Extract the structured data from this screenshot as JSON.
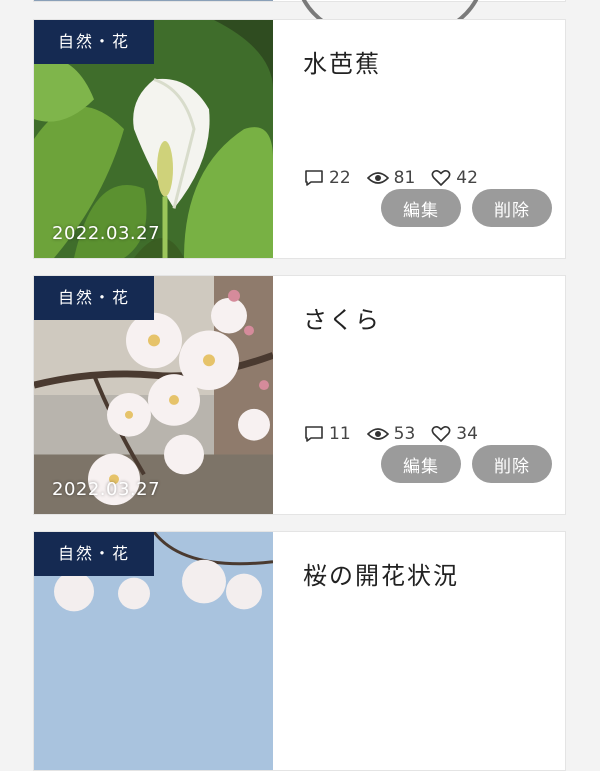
{
  "posts": [
    {
      "category": "自然・花",
      "title": "水芭蕉",
      "date": "2022.03.27",
      "comments": "22",
      "views": "81",
      "likes": "42",
      "edit_label": "編集",
      "delete_label": "削除"
    },
    {
      "category": "自然・花",
      "title": "さくら",
      "date": "2022.03.27",
      "comments": "11",
      "views": "53",
      "likes": "34",
      "edit_label": "編集",
      "delete_label": "削除"
    },
    {
      "category": "自然・花",
      "title": "桜の開花状況"
    }
  ],
  "colors": {
    "category_bg": "#152a52",
    "button_bg": "#9b9b9b",
    "page_bg": "#f3f3f3"
  },
  "icons": [
    "comment-icon",
    "eye-icon",
    "heart-icon"
  ]
}
